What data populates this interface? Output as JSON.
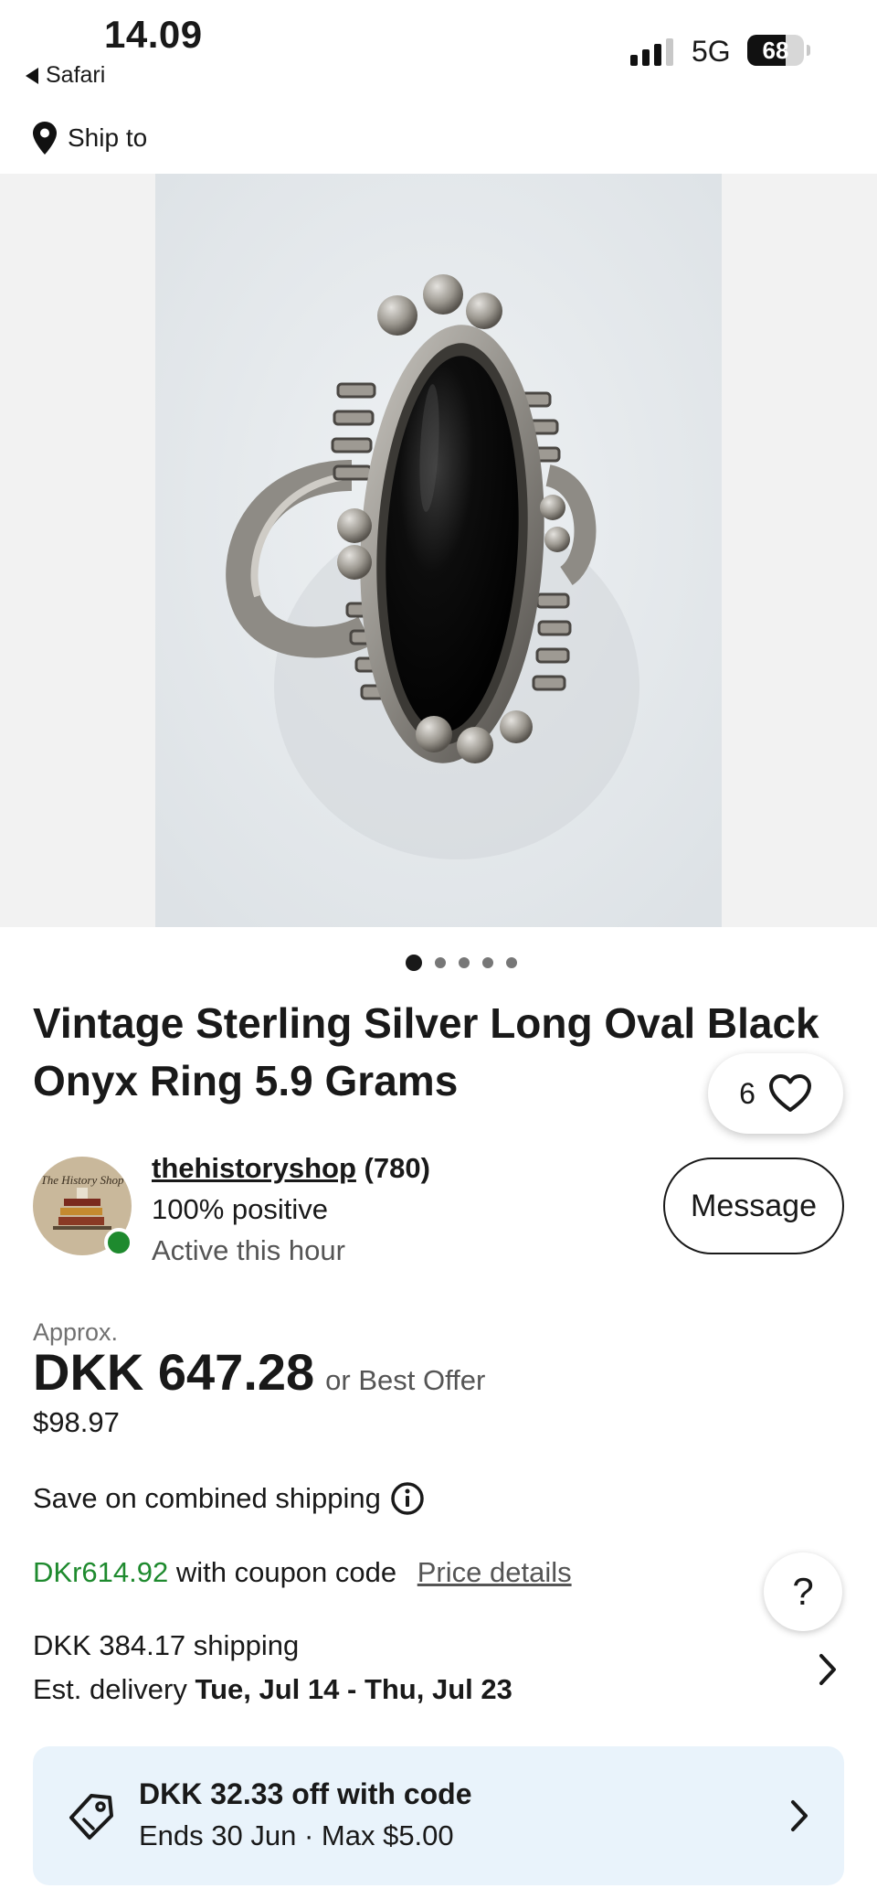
{
  "status_bar": {
    "time": "14.09",
    "back_app": "Safari",
    "network": "5G",
    "battery_text": "68",
    "battery_level": 0.68
  },
  "ship_to": {
    "label": "Ship to"
  },
  "gallery": {
    "image_count": 5,
    "active_index": 0,
    "watch_count": "6"
  },
  "item": {
    "title": "Vintage Sterling Silver Long Oval Black Onyx Ring 5.9 Grams"
  },
  "seller": {
    "avatar_text": "The History Shop",
    "name": "thehistoryshop",
    "feedback_count": "(780)",
    "positive": "100% positive",
    "activity": "Active this hour",
    "message_label": "Message"
  },
  "price": {
    "approx_label": "Approx.",
    "amount": "DKK 647.28",
    "best_offer": "or Best Offer",
    "usd": "$98.97"
  },
  "combined_shipping": {
    "label": "Save on combined shipping"
  },
  "coupon_price": {
    "amount": "DKr614.92",
    "text": "with coupon code",
    "details_link": "Price details"
  },
  "help": {
    "label": "?"
  },
  "shipping": {
    "cost": "DKK 384.17 shipping",
    "delivery_prefix": "Est. delivery",
    "delivery_range": "Tue, Jul 14 - Thu, Jul 23"
  },
  "coupon_banner": {
    "title": "DKK 32.33 off with code",
    "subtitle": "Ends 30 Jun · Max $5.00"
  },
  "colors": {
    "accent_green": "#1e8a2e",
    "banner_bg": "#e9f3fb",
    "text": "#191919"
  }
}
